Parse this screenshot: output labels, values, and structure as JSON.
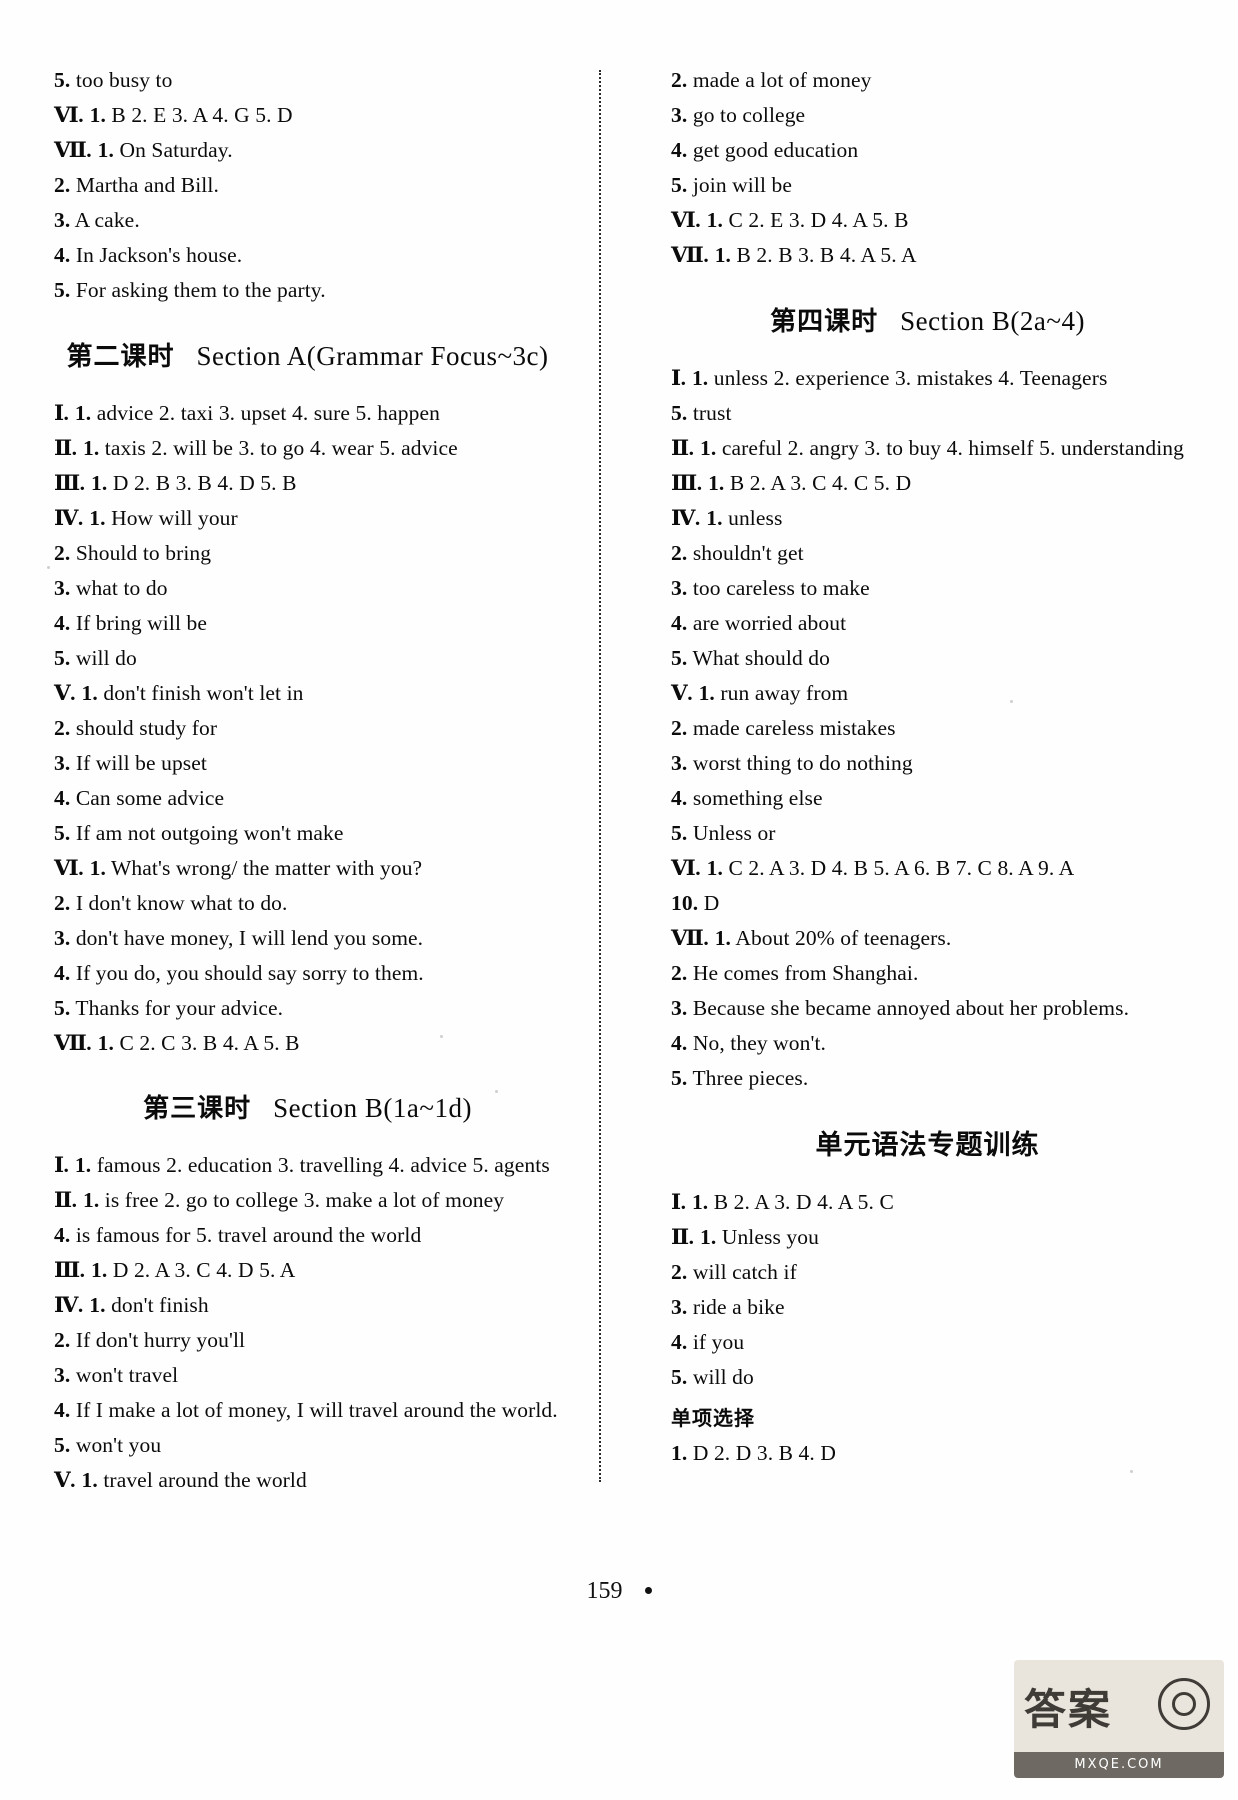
{
  "page": {
    "folio": "159",
    "stamp_logo": "答案",
    "stamp_bar": "MXQE.COM"
  },
  "left_column": {
    "blocks": [
      {
        "type": "lines",
        "lines": [
          {
            "num": "5.",
            "text": "too   busy   to"
          },
          {
            "rn": "Ⅵ.",
            "num": "1.",
            "text": "B   2. E   3. A   4. G   5. D"
          },
          {
            "rn": "Ⅶ.",
            "num": "1.",
            "text": "On Saturday."
          },
          {
            "num": "2.",
            "text": "Martha and Bill."
          },
          {
            "num": "3.",
            "text": "A cake."
          },
          {
            "num": "4.",
            "text": "In Jackson's house."
          },
          {
            "num": "5.",
            "text": "For asking them to the party."
          }
        ]
      },
      {
        "type": "heading",
        "cn": "第二课时",
        "en": "Section A(Grammar Focus~3c)"
      },
      {
        "type": "lines",
        "lines": [
          {
            "rn": "Ⅰ.",
            "num": "1.",
            "text": "advice   2. taxi   3. upset   4. sure   5. happen"
          },
          {
            "rn": "Ⅱ.",
            "num": "1.",
            "text": "taxis   2. will be   3. to go   4. wear   5. advice"
          },
          {
            "rn": "Ⅲ.",
            "num": "1.",
            "text": "D   2. B   3. B   4. D   5. B"
          },
          {
            "rn": "Ⅳ.",
            "num": "1.",
            "text": "How   will   your"
          },
          {
            "num": "2.",
            "text": "Should   to   bring"
          },
          {
            "num": "3.",
            "text": "what   to   do"
          },
          {
            "num": "4.",
            "text": "If   bring   will   be"
          },
          {
            "num": "5.",
            "text": "will   do"
          },
          {
            "rn": "Ⅴ.",
            "num": "1.",
            "text": "don't   finish   won't   let   in"
          },
          {
            "num": "2.",
            "text": "should   study   for"
          },
          {
            "num": "3.",
            "text": "If   will   be   upset"
          },
          {
            "num": "4.",
            "text": "Can   some   advice"
          },
          {
            "num": "5.",
            "text": "If   am   not   outgoing   won't   make"
          },
          {
            "rn": "Ⅵ.",
            "num": "1.",
            "text": "What's wrong/ the matter with you?"
          },
          {
            "num": "2.",
            "text": "I don't know what to do."
          },
          {
            "num": "3.",
            "text": "don't have money, I will lend you some."
          },
          {
            "num": "4.",
            "text": "If you do, you should say sorry to them."
          },
          {
            "num": "5.",
            "text": "Thanks for your advice."
          },
          {
            "rn": "Ⅶ.",
            "num": "1.",
            "text": "C   2. C   3. B   4. A   5. B"
          }
        ]
      },
      {
        "type": "heading",
        "cn": "第三课时",
        "en": "Section B(1a~1d)"
      },
      {
        "type": "lines",
        "lines": [
          {
            "rn": "Ⅰ.",
            "num": "1.",
            "text": "famous   2. education   3. travelling   4. advice   5. agents"
          },
          {
            "rn": "Ⅱ.",
            "num": "1.",
            "text": "is free   2. go to college   3. make a lot of money"
          },
          {
            "num": "4.",
            "text": "is famous for   5. travel around the world"
          },
          {
            "rn": "Ⅲ.",
            "num": "1.",
            "text": "D   2. A   3. C   4. D   5. A"
          },
          {
            "rn": "Ⅳ.",
            "num": "1.",
            "text": "don't   finish"
          },
          {
            "num": "2.",
            "text": "If   don't   hurry   you'll"
          },
          {
            "num": "3.",
            "text": "won't   travel"
          },
          {
            "num": "4.",
            "text": "If I make a lot of money, I will travel around the world."
          },
          {
            "num": "5.",
            "text": "won't   you"
          },
          {
            "rn": "Ⅴ.",
            "num": "1.",
            "text": "travel   around   the   world"
          }
        ]
      }
    ]
  },
  "right_column": {
    "blocks": [
      {
        "type": "lines",
        "lines": [
          {
            "num": "2.",
            "text": "made   a   lot   of   money"
          },
          {
            "num": "3.",
            "text": "go   to   college"
          },
          {
            "num": "4.",
            "text": "get   good   education"
          },
          {
            "num": "5.",
            "text": "join   will   be"
          },
          {
            "rn": "Ⅵ.",
            "num": "1.",
            "text": "C   2. E   3. D   4. A   5. B"
          },
          {
            "rn": "Ⅶ.",
            "num": "1.",
            "text": "B   2. B   3. B   4. A   5. A"
          }
        ]
      },
      {
        "type": "heading",
        "cn": "第四课时",
        "en": "Section B(2a~4)"
      },
      {
        "type": "lines",
        "lines": [
          {
            "rn": "Ⅰ.",
            "num": "1.",
            "text": "unless   2. experience   3. mistakes   4. Teenagers"
          },
          {
            "num": "5.",
            "text": "trust"
          },
          {
            "rn": "Ⅱ.",
            "num": "1.",
            "text": "careful   2. angry   3. to buy   4. himself   5. understanding"
          },
          {
            "rn": "Ⅲ.",
            "num": "1.",
            "text": "B   2. A   3. C   4. C   5. D"
          },
          {
            "rn": "Ⅳ.",
            "num": "1.",
            "text": "unless"
          },
          {
            "num": "2.",
            "text": "shouldn't   get"
          },
          {
            "num": "3.",
            "text": "too   careless   to   make"
          },
          {
            "num": "4.",
            "text": "are   worried   about"
          },
          {
            "num": "5.",
            "text": "What   should   do"
          },
          {
            "rn": "Ⅴ.",
            "num": "1.",
            "text": "run   away   from"
          },
          {
            "num": "2.",
            "text": "made   careless   mistakes"
          },
          {
            "num": "3.",
            "text": "worst   thing   to   do   nothing"
          },
          {
            "num": "4.",
            "text": "something   else"
          },
          {
            "num": "5.",
            "text": "Unless   or"
          },
          {
            "rn": "Ⅵ.",
            "num": "1.",
            "text": "C   2. A   3. D   4. B   5. A   6. B   7. C   8. A   9. A"
          },
          {
            "num": "10.",
            "text": "D"
          },
          {
            "rn": "Ⅶ.",
            "num": "1.",
            "text": "About 20% of teenagers."
          },
          {
            "num": "2.",
            "text": "He comes from Shanghai."
          },
          {
            "num": "3.",
            "text": "Because she became annoyed about her problems."
          },
          {
            "num": "4.",
            "text": "No, they won't."
          },
          {
            "num": "5.",
            "text": "Three pieces."
          }
        ]
      },
      {
        "type": "heading_cn_only",
        "cn": "单元语法专题训练"
      },
      {
        "type": "lines",
        "lines": [
          {
            "rn": "Ⅰ.",
            "num": "1.",
            "text": "B   2. A   3. D   4. A   5. C"
          },
          {
            "rn": "Ⅱ.",
            "num": "1.",
            "text": "Unless   you"
          },
          {
            "num": "2.",
            "text": "will   catch   if"
          },
          {
            "num": "3.",
            "text": "ride   a   bike"
          },
          {
            "num": "4.",
            "text": "if   you"
          },
          {
            "num": "5.",
            "text": "will   do"
          }
        ]
      },
      {
        "type": "subheading",
        "cn": "单项选择"
      },
      {
        "type": "lines",
        "lines": [
          {
            "num": "1.",
            "text": "D   2. D   3. B   4. D"
          }
        ]
      }
    ]
  }
}
